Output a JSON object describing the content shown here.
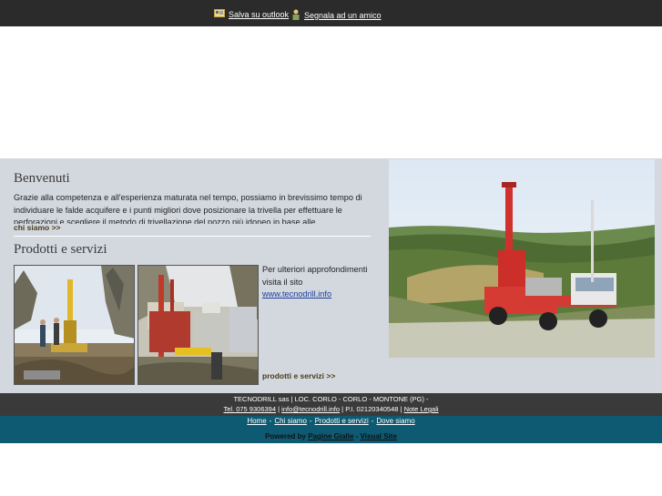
{
  "topbar": {
    "save_outlook": "Salva su outlook",
    "tell_friend": "Segnala ad un amico"
  },
  "welcome": {
    "title": "Benvenuti",
    "text": "Grazie alla competenza e all'esperienza maturata nel tempo, possiamo in brevissimo tempo di individuare le falde acquifere e i punti migliori dove posizionare la trivella per effettuare le perforazioni e scegliere il metodo di trivellazione del pozzo più idoneo in base alle",
    "more": "chi siamo >>"
  },
  "products": {
    "title": "Prodotti e servizi",
    "text_before": "Per ulteriori approfondimenti visita il sito",
    "link": "www.tecnodrill.info",
    "more": "prodotti e servizi >>"
  },
  "footer": {
    "company": "TECNODRILL sas | LOC. CORLO - CORLO - MONTONE (PG) -",
    "tel": "Tel. 075 9306394",
    "sep1": "|",
    "email": "info@tecnodrill.info",
    "vat": "| P.I. 02120340548 |",
    "legal": "Note Legali"
  },
  "nav": {
    "items": [
      "Home",
      "Chi siamo",
      "Prodotti e servizi",
      "Dove siamo"
    ],
    "separator": "-"
  },
  "powered": {
    "label": "Powered by",
    "pagine": "Pagine Gialle",
    "dash": "-",
    "visual": "Visual Site"
  }
}
